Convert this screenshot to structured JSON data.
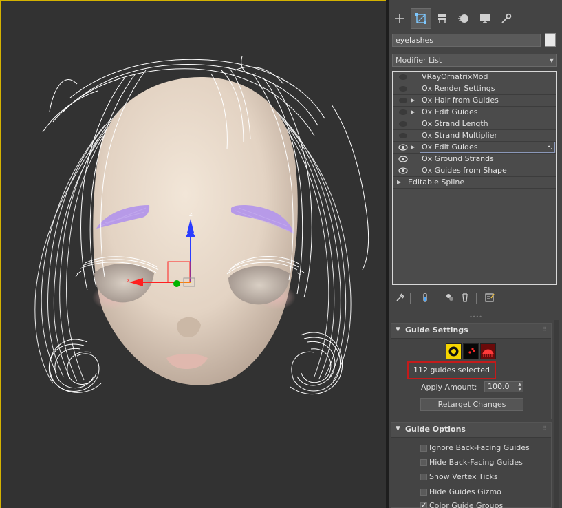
{
  "object_name": "eyelashes",
  "modifier_list": {
    "label": "Modifier List"
  },
  "tabs": [
    {
      "name": "create",
      "icon": "plus-icon"
    },
    {
      "name": "modify",
      "icon": "modify-icon",
      "active": true
    },
    {
      "name": "hierarchy",
      "icon": "hierarchy-icon"
    },
    {
      "name": "motion",
      "icon": "motion-icon"
    },
    {
      "name": "display",
      "icon": "display-icon"
    },
    {
      "name": "utilities",
      "icon": "wrench-icon"
    }
  ],
  "modifier_stack": [
    {
      "label": "VRayOrnatrixMod",
      "eye": "dim",
      "expandable": false
    },
    {
      "label": "Ox Render Settings",
      "eye": "dim",
      "expandable": false
    },
    {
      "label": "Ox Hair from Guides",
      "eye": "dim",
      "expandable": true
    },
    {
      "label": "Ox Edit Guides",
      "eye": "dim",
      "expandable": true
    },
    {
      "label": "Ox Strand Length",
      "eye": "dim",
      "expandable": false
    },
    {
      "label": "Ox Strand Multiplier",
      "eye": "dim",
      "expandable": false
    },
    {
      "label": "Ox Edit Guides",
      "eye": "on",
      "expandable": true,
      "selected": true
    },
    {
      "label": "Ox Ground Strands",
      "eye": "on",
      "expandable": false
    },
    {
      "label": "Ox Guides from Shape",
      "eye": "on",
      "expandable": false
    },
    {
      "label": "Editable Spline",
      "eye": "none",
      "expandable": true
    }
  ],
  "guide_settings": {
    "title": "Guide Settings",
    "selected_count": "112 guides selected",
    "apply_amount_label": "Apply Amount:",
    "apply_amount_value": "100.0",
    "retarget_label": "Retarget Changes"
  },
  "guide_options": {
    "title": "Guide Options",
    "options": [
      {
        "label": "Ignore Back-Facing Guides",
        "checked": false
      },
      {
        "label": "Hide Back-Facing Guides",
        "checked": false
      },
      {
        "label": "Show Vertex Ticks",
        "checked": false
      },
      {
        "label": "Hide Guides Gizmo",
        "checked": false
      },
      {
        "label": "Color Guide Groups",
        "checked": true
      }
    ]
  },
  "viewport": {
    "gizmo_x_label": "x",
    "gizmo_z_label": "z",
    "frame_color": "#d4b200",
    "brow_color": "#b79ae8",
    "hair_color": "#ffffff"
  },
  "colors": {
    "highlight_box": "#c41b1b",
    "selection_outline": "#8a97b8"
  }
}
